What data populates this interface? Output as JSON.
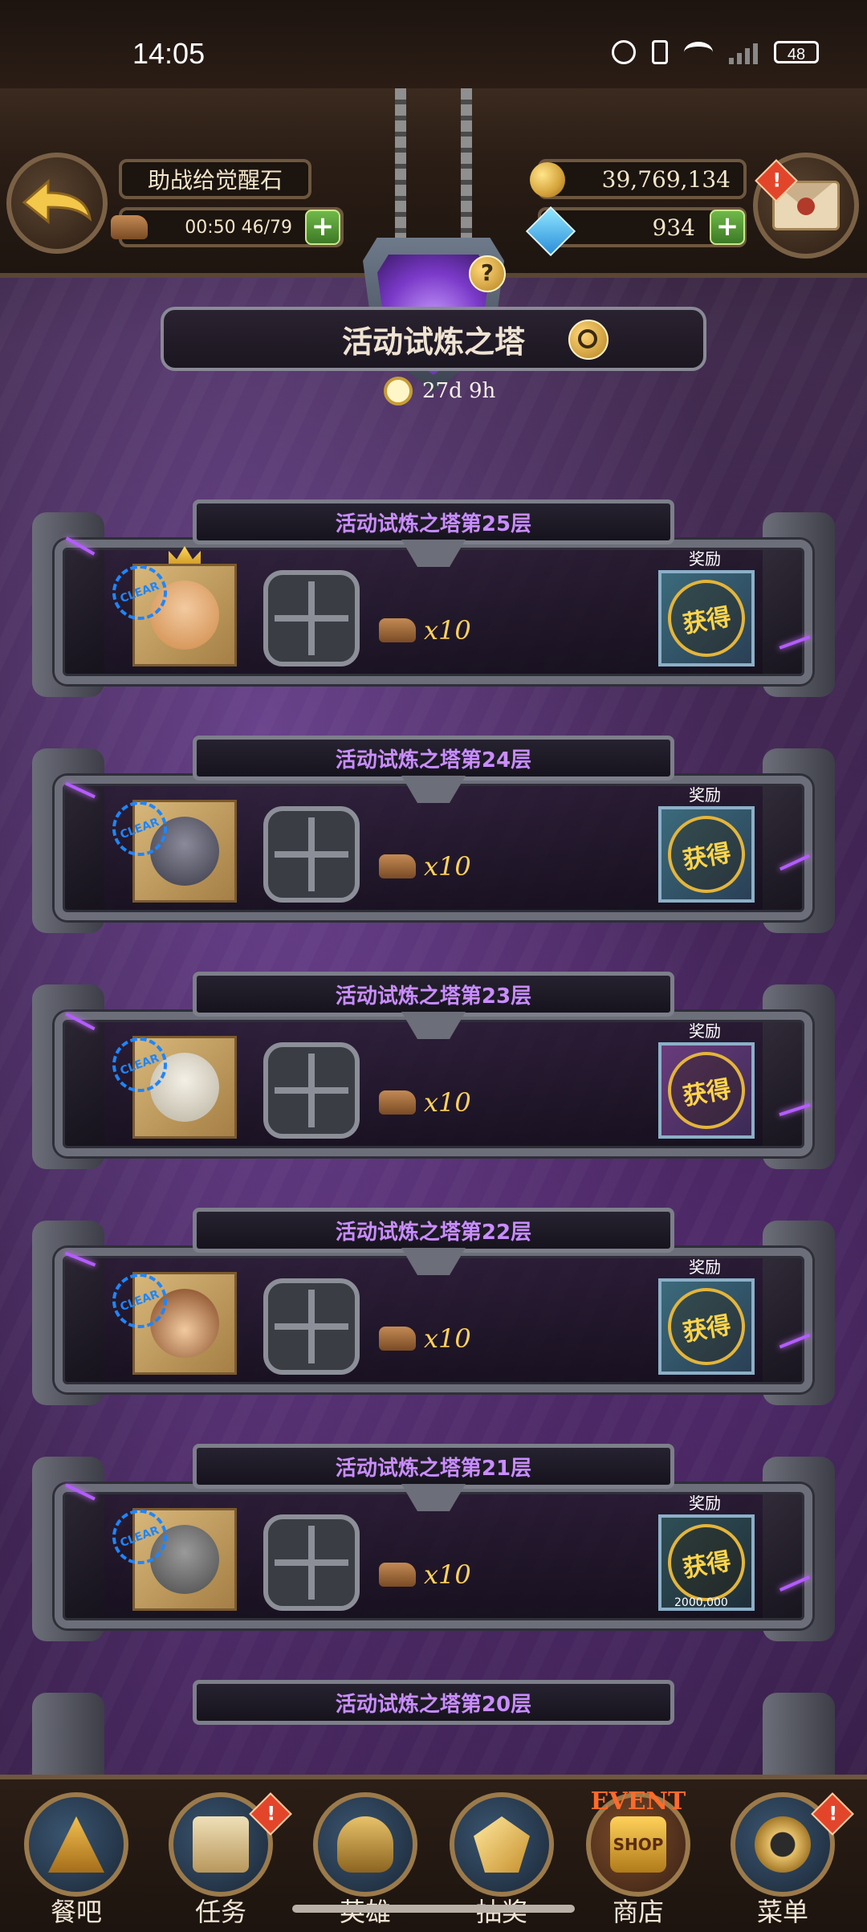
{
  "status_bar": {
    "time": "14:05",
    "battery": "48"
  },
  "header": {
    "support_label": "助战给觉醒石",
    "stamina_value": "00:50 46/79",
    "gold_value": "39,769,134",
    "gem_value": "934",
    "alert_mark": "!"
  },
  "tower": {
    "title": "活动试炼之塔",
    "timer": "27d 9h"
  },
  "floors": [
    {
      "title": "活动试炼之塔第25层",
      "cost": "x10",
      "reward_label": "奖励",
      "reward_status": "获得"
    },
    {
      "title": "活动试炼之塔第24层",
      "cost": "x10",
      "reward_label": "奖励",
      "reward_status": "获得"
    },
    {
      "title": "活动试炼之塔第23层",
      "cost": "x10",
      "reward_label": "奖励",
      "reward_status": "获得"
    },
    {
      "title": "活动试炼之塔第22层",
      "cost": "x10",
      "reward_label": "奖励",
      "reward_status": "获得"
    },
    {
      "title": "活动试炼之塔第21层",
      "cost": "x10",
      "reward_label": "奖励",
      "reward_status": "获得",
      "reward_note": "2000,000"
    },
    {
      "title": "活动试炼之塔第20层"
    }
  ],
  "bottom_nav": [
    {
      "label": "餐吧",
      "icon": "tavern-icon"
    },
    {
      "label": "任务",
      "icon": "quest-scroll-icon",
      "alert": "!"
    },
    {
      "label": "英雄",
      "icon": "helmet-icon"
    },
    {
      "label": "抽奖",
      "icon": "crystal-icon"
    },
    {
      "label": "商店",
      "icon": "event-shop-icon",
      "badge": "EVENT",
      "badge2": "SHOP"
    },
    {
      "label": "菜单",
      "icon": "gear-menu-icon",
      "alert": "!"
    }
  ],
  "colors": {
    "floor_title": "#c98dff",
    "gold_text": "#ffd35a",
    "plus_green": "#5fa53b",
    "stamp_blue": "#1e86ff"
  }
}
